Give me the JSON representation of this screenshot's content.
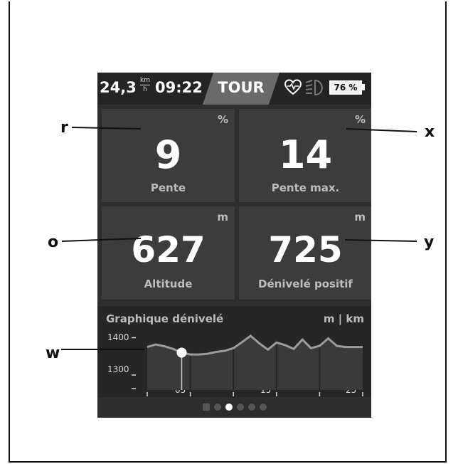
{
  "status_bar": {
    "speed": "24,3",
    "speed_unit_top": "km",
    "speed_unit_bottom": "h",
    "clock": "09:22",
    "mode": "TOUR",
    "battery_label": "76 %",
    "heart_icon": "heart-rate-icon",
    "light_icon": "headlight-icon",
    "battery_icon": "battery-icon"
  },
  "tiles": {
    "pente": {
      "unit": "%",
      "value": "9",
      "label": "Pente"
    },
    "pente_max": {
      "unit": "%",
      "value": "14",
      "label": "Pente max."
    },
    "altitude": {
      "unit": "m",
      "value": "627",
      "label": "Altitude"
    },
    "denivele": {
      "unit": "m",
      "value": "725",
      "label": "Dénivelé positif"
    }
  },
  "elevation_graph": {
    "title": "Graphique dénivelé",
    "unit": "m | km",
    "y_ticks": [
      "1400",
      "1300"
    ],
    "x_ticks": [
      "05",
      "15",
      "25"
    ]
  },
  "page_indicator": {
    "count": 6,
    "active_index": 2
  },
  "callouts": [
    "r",
    "x",
    "o",
    "y",
    "w"
  ],
  "colors": {
    "screen": "#2e2e2e",
    "tile": "#3c3c3c",
    "statusbar": "#242424",
    "mode_plate": "#6a6a6a",
    "profile": "#9c9c9c"
  },
  "chart_data": {
    "type": "area",
    "xlabel": "",
    "ylabel": "",
    "unit": "m | km",
    "xlim": [
      0,
      25
    ],
    "ylim": [
      1260,
      1420
    ],
    "x_ticks": [
      5,
      15,
      25
    ],
    "y_ticks": [
      1300,
      1400
    ],
    "x": [
      0,
      1,
      2,
      3,
      4,
      5,
      6,
      7,
      8,
      9,
      10,
      11,
      12,
      13,
      14,
      15,
      16,
      17,
      18,
      19,
      20,
      21,
      22,
      23,
      24,
      25
    ],
    "y": [
      1375,
      1382,
      1377,
      1370,
      1360,
      1355,
      1355,
      1357,
      1362,
      1365,
      1372,
      1388,
      1405,
      1385,
      1368,
      1387,
      1380,
      1370,
      1395,
      1372,
      1378,
      1398,
      1378,
      1375,
      1375,
      1375
    ],
    "current_position_x": 4.0
  }
}
